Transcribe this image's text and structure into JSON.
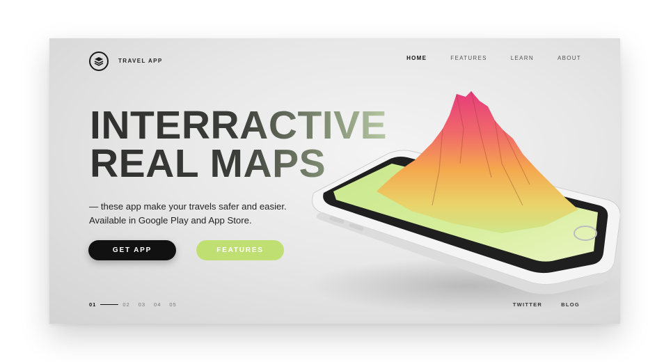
{
  "header": {
    "logo_icon": "layers-icon",
    "brand": "TRAVEL APP",
    "nav": [
      {
        "label": "HOME",
        "active": true
      },
      {
        "label": "FEATURES",
        "active": false
      },
      {
        "label": "LEARN",
        "active": false
      },
      {
        "label": "ABOUT",
        "active": false
      }
    ]
  },
  "hero": {
    "headline_line1": "INTERRACTIVE",
    "headline_line2": "REAL MAPS",
    "subtext_line1": "— these app make your travels safer and easier.",
    "subtext_line2": "Available in Google Play and App Store."
  },
  "buttons": {
    "get_app": "GET APP",
    "features": "FEATURES"
  },
  "pager": {
    "active": "01",
    "pages": [
      "02",
      "03",
      "04",
      "05"
    ]
  },
  "footer": {
    "links": [
      "TWITTER",
      "BLOG"
    ]
  },
  "colors": {
    "accent_green": "#bfdf73",
    "dark": "#111111",
    "mountain_pink": "#e8457a",
    "mountain_orange": "#f2a24a"
  },
  "images": {
    "hero_visual": "phone-with-3d-mountain-map"
  }
}
